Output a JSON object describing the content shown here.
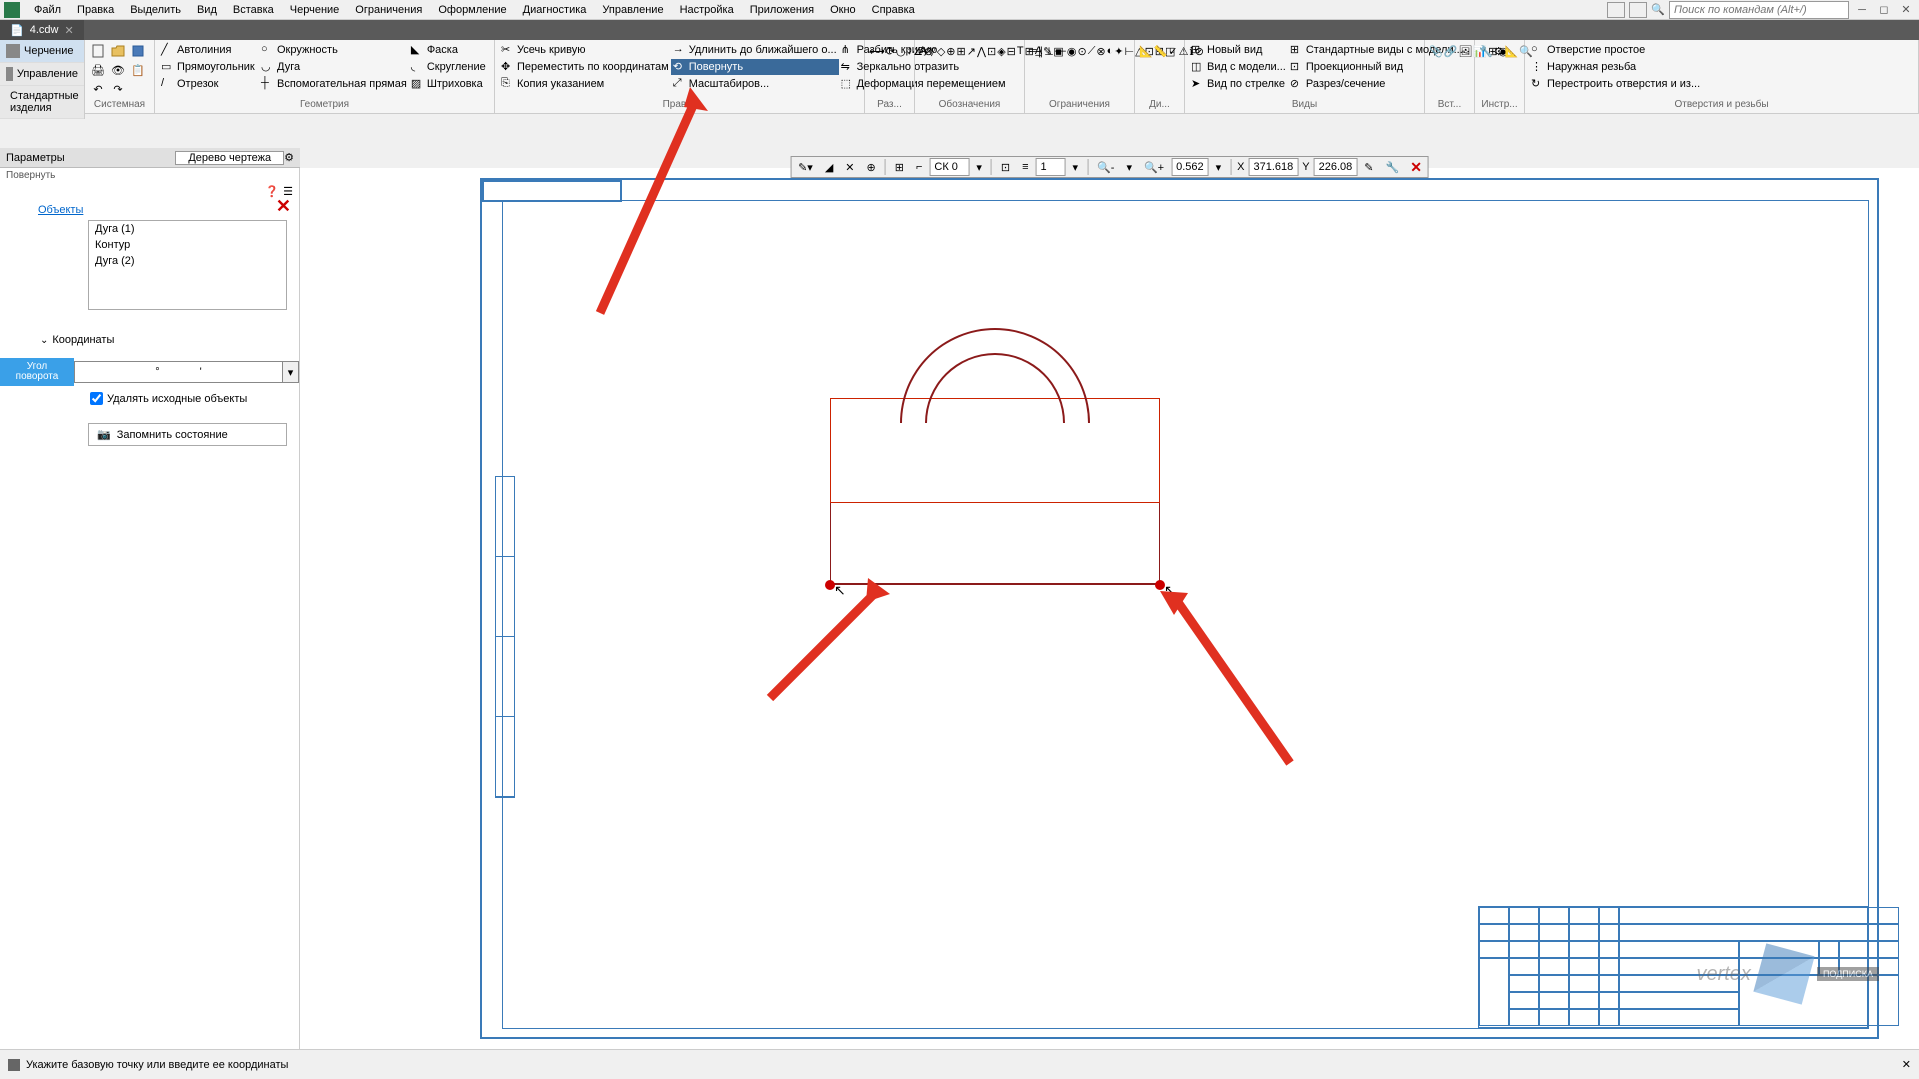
{
  "menu": [
    "Файл",
    "Правка",
    "Выделить",
    "Вид",
    "Вставка",
    "Черчение",
    "Ограничения",
    "Оформление",
    "Диагностика",
    "Управление",
    "Настройка",
    "Приложения",
    "Окно",
    "Справка"
  ],
  "search_placeholder": "Поиск по командам (Alt+/)",
  "tab": {
    "name": "4.cdw"
  },
  "modes": {
    "drawing": "Черчение",
    "manage": "Управление",
    "std": "Стандартные изделия"
  },
  "ribbon": {
    "system_label": "Системная",
    "geometry": {
      "label": "Геометрия",
      "autoline": "Автолиния",
      "circle": "Окружность",
      "chamfer": "Фаска",
      "rect": "Прямоугольник",
      "arc": "Дуга",
      "fillet": "Скругление",
      "segment": "Отрезок",
      "aux_line": "Вспомогательная прямая",
      "hatch": "Штриховка"
    },
    "edit": {
      "label": "Правка",
      "trim": "Усечь кривую",
      "extend": "Удлинить до ближайшего о...",
      "split": "Разбить кривую",
      "move": "Переместить по координатам",
      "rotate": "Повернуть",
      "mirror": "Зеркально отразить",
      "copy": "Копия указанием",
      "scale": "Масштабиров...",
      "deform": "Деформация перемещением"
    },
    "dims_label": "Раз...",
    "annot_label": "Обозначения",
    "constr_label": "Ограничения",
    "diag_label": "Ди...",
    "views": {
      "label": "Виды",
      "new_view": "Новый вид",
      "std_views": "Стандартные виды с модели...",
      "model_view": "Вид с модели...",
      "proj_view": "Проекционный вид",
      "arrow_view": "Вид по стрелке",
      "section": "Разрез/сечение"
    },
    "insert_label": "Вст...",
    "tools_label": "Инстр...",
    "holes": {
      "label": "Отверстия и резьбы",
      "simple": "Отверстие простое",
      "ext_thread": "Наружная резьба",
      "rebuild": "Перестроить отверстия и из..."
    }
  },
  "canvas_toolbar": {
    "cs": "СК 0",
    "scale": "1",
    "zoom": "0.562",
    "x": "371.618",
    "y": "226.08",
    "x_label": "X",
    "y_label": "Y"
  },
  "params": {
    "header": "Параметры",
    "tree": "Дерево чертежа",
    "title": "Повернуть",
    "objects_link": "Объекты",
    "obj_items": [
      "Дуга (1)",
      "Контур",
      "Дуга (2)"
    ],
    "coords": "Координаты",
    "angle_label": "Угол поворота",
    "angle_deg": "°",
    "angle_min": "'",
    "delete_src": "Удалять исходные объекты",
    "save_state": "Запомнить состояние"
  },
  "status": "Укажите базовую точку или введите ее координаты",
  "watermark": {
    "brand": "vertex",
    "badge": "ПОДПИСКА"
  }
}
